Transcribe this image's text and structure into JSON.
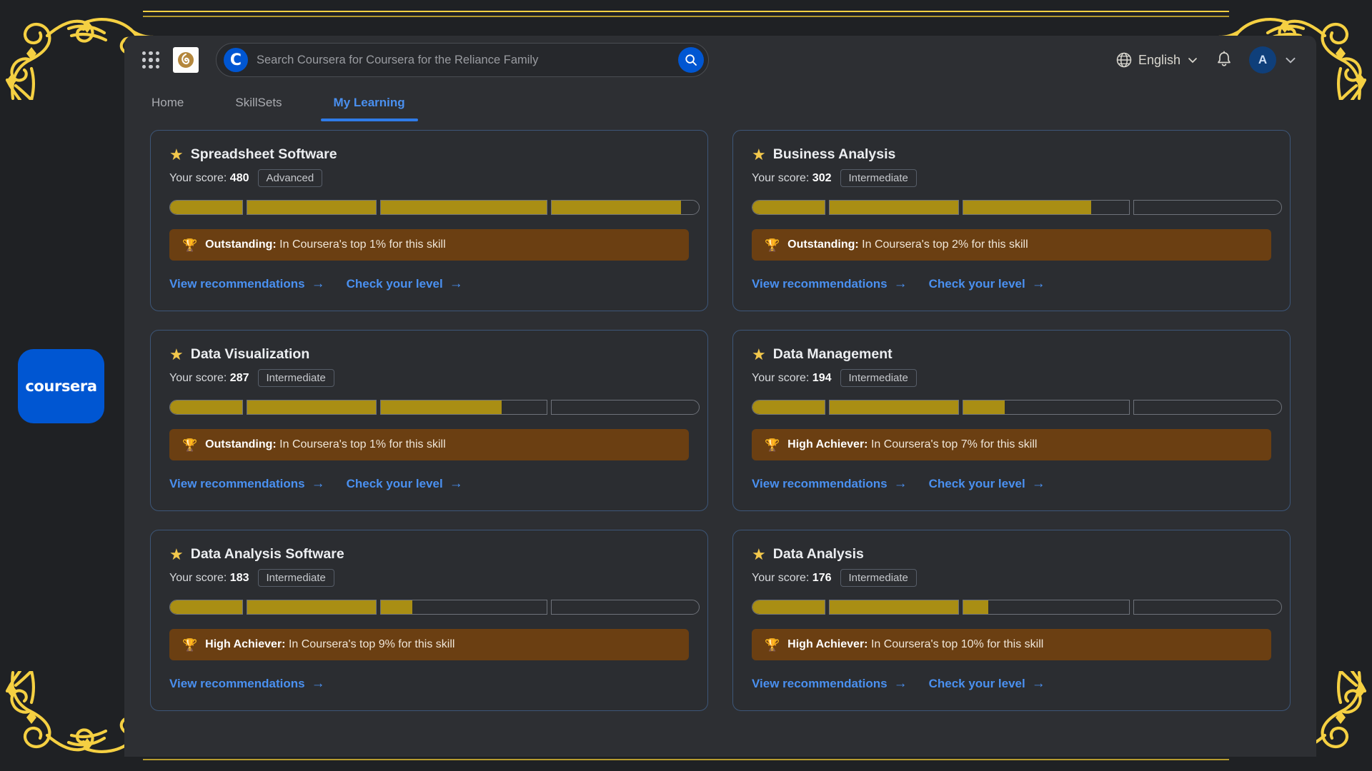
{
  "window": {
    "header": {
      "apps_grid_icon": "grid-apps-icon",
      "brand_logo_icon": "reliance-logo-icon",
      "search": {
        "placeholder": "Search Coursera for Coursera for the Reliance Family",
        "value": "",
        "logo_icon": "coursera-c-icon",
        "submit_icon": "search-icon"
      },
      "language": {
        "label": "English",
        "icon": "globe-icon",
        "chevron": "chevron-down-icon"
      },
      "notifications_icon": "bell-icon",
      "account": {
        "initial": "A",
        "chevron": "chevron-down-icon"
      }
    },
    "nav": {
      "tabs": [
        {
          "label": "Home",
          "active": false
        },
        {
          "label": "SkillSets",
          "active": false
        },
        {
          "label": "My Learning",
          "active": true
        }
      ]
    }
  },
  "desktop": {
    "coursera_tile_label": "coursera",
    "ornament_color": "#f5d042",
    "accent_blue": "#0056d2",
    "progress_fill_color": "#a98e14",
    "achievement_bg_color": "#6b3f12"
  },
  "labels": {
    "score_prefix": "Your score:",
    "view_recommendations": "View recommendations",
    "check_your_level": "Check your level",
    "arrow": "→",
    "star_icon": "star-icon",
    "trophy_icon": "trophy-icon"
  },
  "cards": [
    {
      "title": "Spreadsheet Software",
      "score": "480",
      "level": "Advanced",
      "segments": [
        100,
        100,
        100,
        88
      ],
      "achievement_label": "Outstanding:",
      "achievement_text": "In Coursera's top 1% for this skill",
      "links": [
        "View recommendations",
        "Check your level"
      ]
    },
    {
      "title": "Business Analysis",
      "score": "302",
      "level": "Intermediate",
      "segments": [
        100,
        100,
        77,
        0
      ],
      "achievement_label": "Outstanding:",
      "achievement_text": "In Coursera's top 2% for this skill",
      "links": [
        "View recommendations",
        "Check your level"
      ]
    },
    {
      "title": "Data Visualization",
      "score": "287",
      "level": "Intermediate",
      "segments": [
        100,
        100,
        73,
        0
      ],
      "achievement_label": "Outstanding:",
      "achievement_text": "In Coursera's top 1% for this skill",
      "links": [
        "View recommendations",
        "Check your level"
      ]
    },
    {
      "title": "Data Management",
      "score": "194",
      "level": "Intermediate",
      "segments": [
        100,
        100,
        25,
        0
      ],
      "achievement_label": "High Achiever:",
      "achievement_text": "In Coursera's top 7% for this skill",
      "links": [
        "View recommendations",
        "Check your level"
      ]
    },
    {
      "title": "Data Analysis Software",
      "score": "183",
      "level": "Intermediate",
      "segments": [
        100,
        100,
        19,
        0
      ],
      "achievement_label": "High Achiever:",
      "achievement_text": "In Coursera's top 9% for this skill",
      "links": [
        "View recommendations"
      ]
    },
    {
      "title": "Data Analysis",
      "score": "176",
      "level": "Intermediate",
      "segments": [
        100,
        100,
        15,
        0
      ],
      "achievement_label": "High Achiever:",
      "achievement_text": "In Coursera's top 10% for this skill",
      "links": [
        "View recommendations",
        "Check your level"
      ]
    }
  ]
}
